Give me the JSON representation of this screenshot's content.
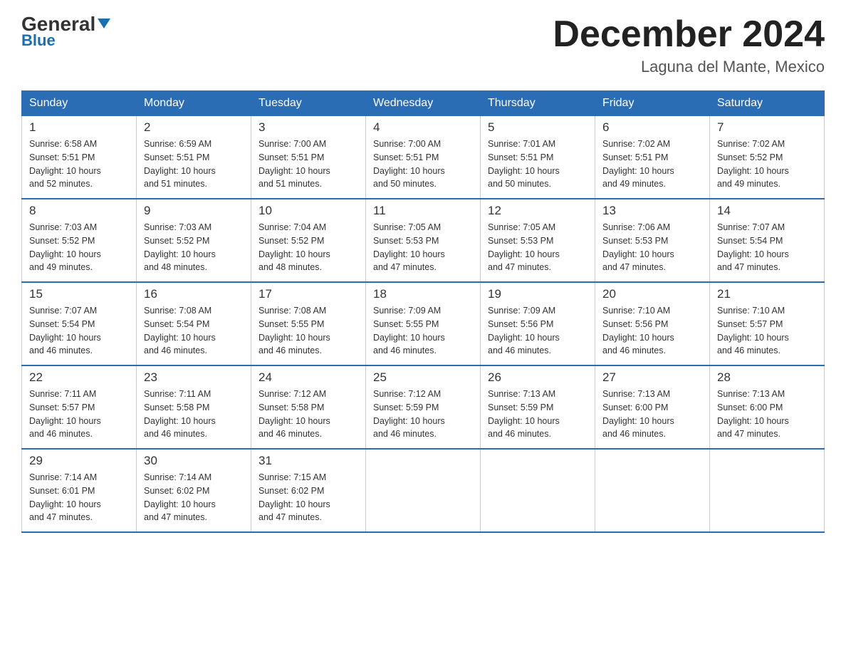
{
  "logo": {
    "general": "General",
    "blue": "Blue"
  },
  "title": "December 2024",
  "location": "Laguna del Mante, Mexico",
  "days": [
    "Sunday",
    "Monday",
    "Tuesday",
    "Wednesday",
    "Thursday",
    "Friday",
    "Saturday"
  ],
  "weeks": [
    [
      {
        "num": "1",
        "info": "Sunrise: 6:58 AM\nSunset: 5:51 PM\nDaylight: 10 hours\nand 52 minutes."
      },
      {
        "num": "2",
        "info": "Sunrise: 6:59 AM\nSunset: 5:51 PM\nDaylight: 10 hours\nand 51 minutes."
      },
      {
        "num": "3",
        "info": "Sunrise: 7:00 AM\nSunset: 5:51 PM\nDaylight: 10 hours\nand 51 minutes."
      },
      {
        "num": "4",
        "info": "Sunrise: 7:00 AM\nSunset: 5:51 PM\nDaylight: 10 hours\nand 50 minutes."
      },
      {
        "num": "5",
        "info": "Sunrise: 7:01 AM\nSunset: 5:51 PM\nDaylight: 10 hours\nand 50 minutes."
      },
      {
        "num": "6",
        "info": "Sunrise: 7:02 AM\nSunset: 5:51 PM\nDaylight: 10 hours\nand 49 minutes."
      },
      {
        "num": "7",
        "info": "Sunrise: 7:02 AM\nSunset: 5:52 PM\nDaylight: 10 hours\nand 49 minutes."
      }
    ],
    [
      {
        "num": "8",
        "info": "Sunrise: 7:03 AM\nSunset: 5:52 PM\nDaylight: 10 hours\nand 49 minutes."
      },
      {
        "num": "9",
        "info": "Sunrise: 7:03 AM\nSunset: 5:52 PM\nDaylight: 10 hours\nand 48 minutes."
      },
      {
        "num": "10",
        "info": "Sunrise: 7:04 AM\nSunset: 5:52 PM\nDaylight: 10 hours\nand 48 minutes."
      },
      {
        "num": "11",
        "info": "Sunrise: 7:05 AM\nSunset: 5:53 PM\nDaylight: 10 hours\nand 47 minutes."
      },
      {
        "num": "12",
        "info": "Sunrise: 7:05 AM\nSunset: 5:53 PM\nDaylight: 10 hours\nand 47 minutes."
      },
      {
        "num": "13",
        "info": "Sunrise: 7:06 AM\nSunset: 5:53 PM\nDaylight: 10 hours\nand 47 minutes."
      },
      {
        "num": "14",
        "info": "Sunrise: 7:07 AM\nSunset: 5:54 PM\nDaylight: 10 hours\nand 47 minutes."
      }
    ],
    [
      {
        "num": "15",
        "info": "Sunrise: 7:07 AM\nSunset: 5:54 PM\nDaylight: 10 hours\nand 46 minutes."
      },
      {
        "num": "16",
        "info": "Sunrise: 7:08 AM\nSunset: 5:54 PM\nDaylight: 10 hours\nand 46 minutes."
      },
      {
        "num": "17",
        "info": "Sunrise: 7:08 AM\nSunset: 5:55 PM\nDaylight: 10 hours\nand 46 minutes."
      },
      {
        "num": "18",
        "info": "Sunrise: 7:09 AM\nSunset: 5:55 PM\nDaylight: 10 hours\nand 46 minutes."
      },
      {
        "num": "19",
        "info": "Sunrise: 7:09 AM\nSunset: 5:56 PM\nDaylight: 10 hours\nand 46 minutes."
      },
      {
        "num": "20",
        "info": "Sunrise: 7:10 AM\nSunset: 5:56 PM\nDaylight: 10 hours\nand 46 minutes."
      },
      {
        "num": "21",
        "info": "Sunrise: 7:10 AM\nSunset: 5:57 PM\nDaylight: 10 hours\nand 46 minutes."
      }
    ],
    [
      {
        "num": "22",
        "info": "Sunrise: 7:11 AM\nSunset: 5:57 PM\nDaylight: 10 hours\nand 46 minutes."
      },
      {
        "num": "23",
        "info": "Sunrise: 7:11 AM\nSunset: 5:58 PM\nDaylight: 10 hours\nand 46 minutes."
      },
      {
        "num": "24",
        "info": "Sunrise: 7:12 AM\nSunset: 5:58 PM\nDaylight: 10 hours\nand 46 minutes."
      },
      {
        "num": "25",
        "info": "Sunrise: 7:12 AM\nSunset: 5:59 PM\nDaylight: 10 hours\nand 46 minutes."
      },
      {
        "num": "26",
        "info": "Sunrise: 7:13 AM\nSunset: 5:59 PM\nDaylight: 10 hours\nand 46 minutes."
      },
      {
        "num": "27",
        "info": "Sunrise: 7:13 AM\nSunset: 6:00 PM\nDaylight: 10 hours\nand 46 minutes."
      },
      {
        "num": "28",
        "info": "Sunrise: 7:13 AM\nSunset: 6:00 PM\nDaylight: 10 hours\nand 47 minutes."
      }
    ],
    [
      {
        "num": "29",
        "info": "Sunrise: 7:14 AM\nSunset: 6:01 PM\nDaylight: 10 hours\nand 47 minutes."
      },
      {
        "num": "30",
        "info": "Sunrise: 7:14 AM\nSunset: 6:02 PM\nDaylight: 10 hours\nand 47 minutes."
      },
      {
        "num": "31",
        "info": "Sunrise: 7:15 AM\nSunset: 6:02 PM\nDaylight: 10 hours\nand 47 minutes."
      },
      null,
      null,
      null,
      null
    ]
  ]
}
